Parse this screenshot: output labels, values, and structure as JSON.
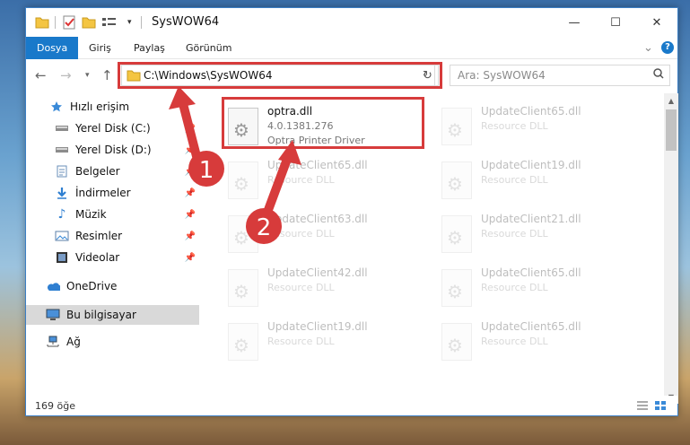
{
  "window": {
    "title": "SysWOW64",
    "controls": {
      "minimize": "—",
      "maximize": "☐",
      "close": "✕"
    }
  },
  "ribbon": {
    "tabs": [
      "Dosya",
      "Giriş",
      "Paylaş",
      "Görünüm"
    ],
    "expand_glyph": "⌄",
    "help_glyph": "?"
  },
  "nav": {
    "address": "C:\\Windows\\SysWOW64",
    "search_placeholder": "Ara: SysWOW64"
  },
  "sidebar": {
    "items": [
      {
        "label": "Hızlı erişim",
        "icon": "star-icon",
        "pinned": false
      },
      {
        "label": "Yerel Disk (C:)",
        "icon": "drive-icon",
        "pinned": true
      },
      {
        "label": "Yerel Disk (D:)",
        "icon": "drive-icon",
        "pinned": true
      },
      {
        "label": "Belgeler",
        "icon": "document-icon",
        "pinned": true
      },
      {
        "label": "İndirmeler",
        "icon": "download-icon",
        "pinned": true
      },
      {
        "label": "Müzik",
        "icon": "music-icon",
        "pinned": true
      },
      {
        "label": "Resimler",
        "icon": "pictures-icon",
        "pinned": true
      },
      {
        "label": "Videolar",
        "icon": "video-icon",
        "pinned": true
      },
      {
        "label": "OneDrive",
        "icon": "cloud-icon",
        "pinned": false
      },
      {
        "label": "Bu bilgisayar",
        "icon": "computer-icon",
        "pinned": false,
        "selected": true
      },
      {
        "label": "Ağ",
        "icon": "network-icon",
        "pinned": false
      }
    ]
  },
  "files": {
    "main": {
      "name": "optra.dll",
      "version": "4.0.1381.276",
      "description": "Optra Printer Driver"
    },
    "background": [
      {
        "name": "UpdateClient65.dll",
        "description": "Resource DLL"
      },
      {
        "name": "UpdateClient65.dll",
        "description": "Resource DLL"
      },
      {
        "name": "UpdateClient19.dll",
        "description": "Resource DLL"
      },
      {
        "name": "UpdateClient63.dll",
        "description": "Resource DLL"
      },
      {
        "name": "UpdateClient21.dll",
        "description": "Resource DLL"
      },
      {
        "name": "UpdateClient42.dll",
        "description": "Resource DLL"
      },
      {
        "name": "UpdateClient65.dll",
        "description": "Resource DLL"
      },
      {
        "name": "UpdateClient19.dll",
        "description": "Resource DLL"
      },
      {
        "name": "UpdateClient65.dll",
        "description": "Resource DLL"
      }
    ]
  },
  "status": {
    "item_count": "169 öğe"
  },
  "annotations": {
    "step1": "1",
    "step2": "2",
    "color": "#d73b3b"
  }
}
